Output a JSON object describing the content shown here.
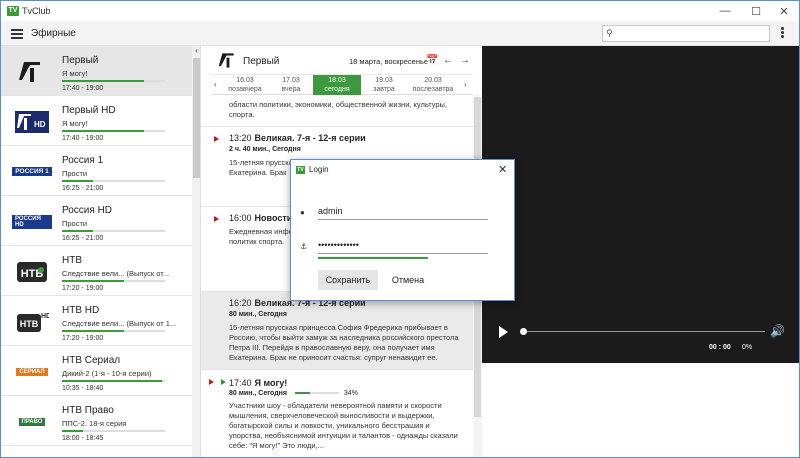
{
  "window": {
    "app_title": "TvClub",
    "min_icon": "minimize-icon",
    "max_icon": "maximize-icon",
    "close_icon": "close-icon"
  },
  "appbar": {
    "section": "Эфирные",
    "search_placeholder": ""
  },
  "channels": [
    {
      "name": "Первый",
      "program": "Я могу!",
      "time": "17:40 - 19:00",
      "progress": 0.8,
      "active": true
    },
    {
      "name": "Первый HD",
      "program": "Я могу!",
      "time": "17:40 - 19:00",
      "progress": 0.8
    },
    {
      "name": "Россия 1",
      "program": "Прости",
      "time": "16:25 - 21:00",
      "progress": 0.3
    },
    {
      "name": "Россия HD",
      "program": "Прости",
      "time": "16:25 - 21:00",
      "progress": 0.3
    },
    {
      "name": "НТВ",
      "program": "Следствие вели... (Выпуск от...",
      "time": "17:20 - 19:00",
      "progress": 0.6
    },
    {
      "name": "НТВ HD",
      "program": "Следствие вели... (Выпуск от 1...",
      "time": "17:20 - 19:00",
      "progress": 0.6
    },
    {
      "name": "НТВ Сериал",
      "program": "Дикий-2 (1-я - 10-я серии)",
      "time": "10:35 - 18:40",
      "progress": 0.97
    },
    {
      "name": "НТВ Право",
      "program": "ППС-2. 18-я серия",
      "time": "18:00 - 18:45",
      "progress": 0.2
    }
  ],
  "channel_logos": {
    "ntv_sub": "HD",
    "russia1": "РОССИЯ 1",
    "russiahd": "РОССИЯ HD",
    "serial": "СЕРИАЛ",
    "pravo": "ПРАВО"
  },
  "program_panel": {
    "channel": "Первый",
    "date": "18 марта, воскресенье",
    "days": [
      {
        "date": "16.03",
        "label": "позавчера"
      },
      {
        "date": "17.03",
        "label": "вчера"
      },
      {
        "date": "18.03",
        "label": "сегодня",
        "selected": true
      },
      {
        "date": "19.03",
        "label": "завтра"
      },
      {
        "date": "20.03",
        "label": "послезавтра"
      }
    ],
    "top_desc": "области политики, экономики, общественной жизни, культуры, спорта.",
    "entries": [
      {
        "time": "13:20",
        "title": "Великая. 7-я - 12-я серии",
        "meta": "2 ч. 40 мин., Сегодня",
        "desc": "15-летняя прусска Россию, чтобы вый Петра III. Перейд Екатерина. Брак"
      },
      {
        "time": "16:00",
        "title": "Новости",
        "meta": "",
        "desc": "Ежедневная инфо важных событиях рассказываем зри области политик спорта."
      },
      {
        "time": "16:20",
        "title": "Великая. 7-я - 12-я серии",
        "meta": "80 мин., Сегодня",
        "desc": "15-летняя прусская принцесса София Фредерика прибывает в Россию, чтобы выйти замуж за наследника российского престола Петра III. Перейдя в православную веру, она получает имя Екатерина. Брак не приносит счастья: супруг ненавидит ее."
      },
      {
        "time": "17:40",
        "title": "Я могу!",
        "meta": "80 мин., Сегодня",
        "progress_label": "34%",
        "progress": 0.34,
        "desc": "Участники шоу - обладатели невероятной памяти и скорости мышления, сверхчеловеческой выносливости и выдержки, богатырской силы и ловкости, уникального бесстрашия и упорства, необъяснимой интуиции и талантов - однажды сказали себе: \"Я могу!\" Это люди,..."
      }
    ]
  },
  "player": {
    "time": "00 : 00",
    "percent": "0%",
    "progress": 0
  },
  "login": {
    "title": "Login",
    "username": "admin",
    "password": "•••••••••••••",
    "save": "Сохранить",
    "cancel": "Отмена"
  }
}
